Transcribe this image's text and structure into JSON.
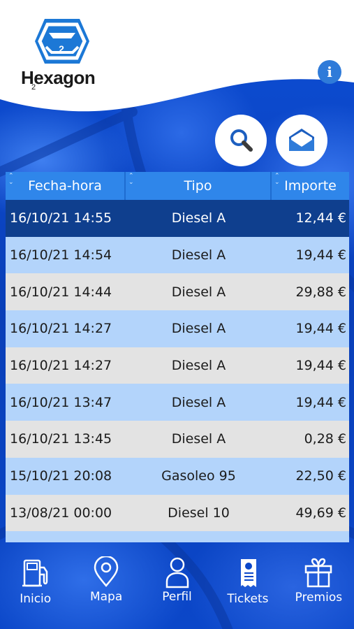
{
  "brand": {
    "name": "Hexagon",
    "mark_number": "2",
    "colors": {
      "primary_blue": "#0b47c9",
      "header_blue": "#2f86ea",
      "selected_row": "#0f3f8e",
      "row_blue": "#b3d4fb",
      "row_grey": "#e3e3e3"
    }
  },
  "header": {
    "info_label": "i"
  },
  "actions": {
    "search_icon": "search-icon",
    "message_icon": "envelope-open-icon"
  },
  "table": {
    "columns": [
      "Fecha-hora",
      "Tipo",
      "Importe"
    ],
    "rows": [
      {
        "fecha": "16/10/21 14:55",
        "tipo": "Diesel A",
        "importe": "12,44 €"
      },
      {
        "fecha": "16/10/21 14:54",
        "tipo": "Diesel A",
        "importe": "19,44 €"
      },
      {
        "fecha": "16/10/21 14:44",
        "tipo": "Diesel A",
        "importe": "29,88 €"
      },
      {
        "fecha": "16/10/21 14:27",
        "tipo": "Diesel A",
        "importe": "19,44 €"
      },
      {
        "fecha": "16/10/21 14:27",
        "tipo": "Diesel A",
        "importe": "19,44 €"
      },
      {
        "fecha": "16/10/21 13:47",
        "tipo": "Diesel A",
        "importe": "19,44 €"
      },
      {
        "fecha": "16/10/21 13:45",
        "tipo": "Diesel A",
        "importe": "0,28 €"
      },
      {
        "fecha": "15/10/21 20:08",
        "tipo": "Gasoleo 95",
        "importe": "22,50 €"
      },
      {
        "fecha": "13/08/21 00:00",
        "tipo": "Diesel 10",
        "importe": "49,69 €"
      }
    ]
  },
  "nav": {
    "items": [
      {
        "label": "Inicio",
        "icon": "fuel-pump-icon"
      },
      {
        "label": "Mapa",
        "icon": "map-pin-icon"
      },
      {
        "label": "Perfil",
        "icon": "user-icon"
      },
      {
        "label": "Tickets",
        "icon": "ticket-icon"
      },
      {
        "label": "Premios",
        "icon": "gift-icon"
      }
    ]
  }
}
